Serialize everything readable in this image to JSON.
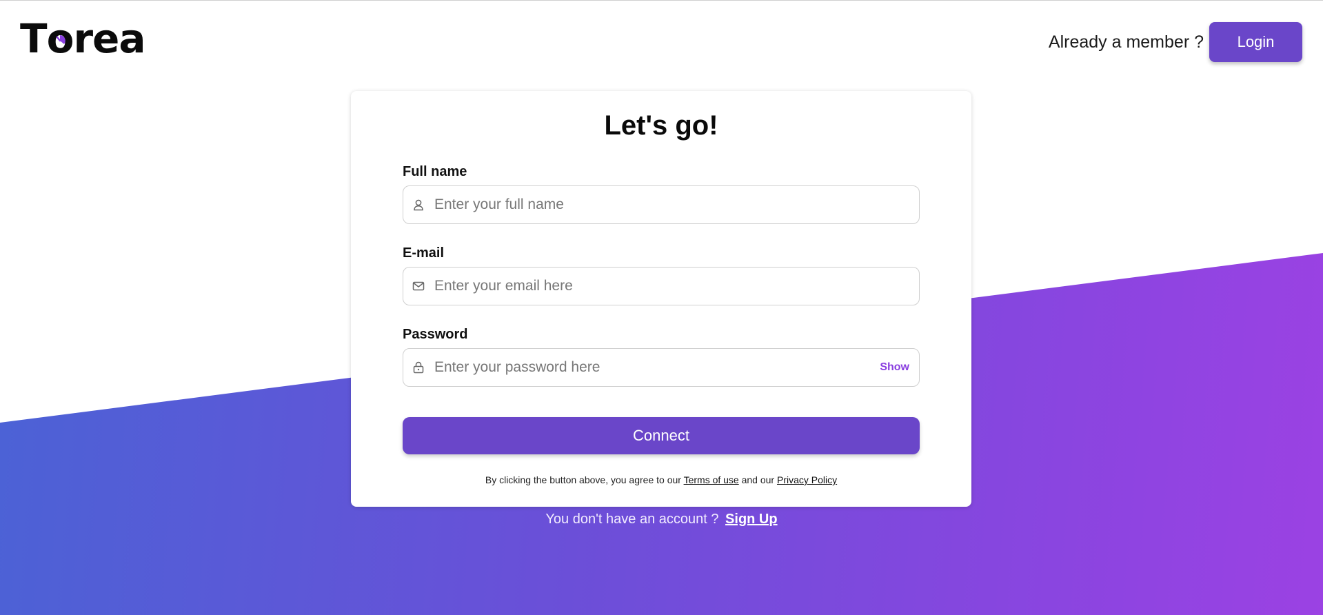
{
  "brand": {
    "logo_text_pre": "T",
    "logo_text_mid": "o",
    "logo_text_post": "rea",
    "accent": "#6a46c9",
    "clock_accent": "#8a3fe0"
  },
  "header": {
    "member_text": "Already a member ?",
    "login_label": "Login"
  },
  "card": {
    "title": "Let's go!",
    "fields": [
      {
        "label": "Full name",
        "placeholder": "Enter your full name",
        "icon": "user-icon"
      },
      {
        "label": "E-mail",
        "placeholder": "Enter your email here",
        "icon": "mail-icon"
      },
      {
        "label": "Password",
        "placeholder": "Enter your password here",
        "icon": "lock-icon",
        "toggle": "Show"
      }
    ],
    "submit_label": "Connect",
    "terms": {
      "prefix": "By clicking the button above, you agree to our",
      "terms_link": "Terms of use",
      "middle": "and our",
      "privacy_link": "Privacy Policy"
    }
  },
  "footer": {
    "prompt": "You don't have an account ?",
    "signup_link": "Sign Up"
  },
  "colors": {
    "gradient_start": "#4a63d6",
    "gradient_end": "#9b42e3",
    "toggle": "#8a3fe0"
  }
}
